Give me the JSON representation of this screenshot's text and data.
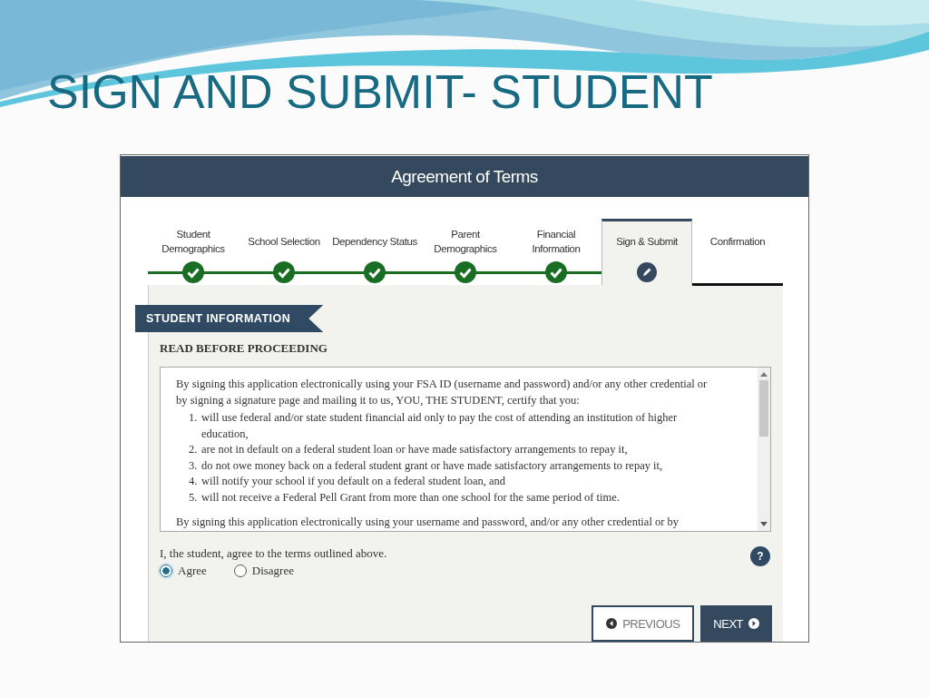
{
  "slide_title": "SIGN AND SUBMIT- STUDENT",
  "page_header": "Agreement of Terms",
  "steps": [
    {
      "label": "Student Demographics",
      "complete": true,
      "selected": false
    },
    {
      "label": "School Selection",
      "complete": true,
      "selected": false
    },
    {
      "label": "Dependency Status",
      "complete": true,
      "selected": false
    },
    {
      "label": "Parent Demographics",
      "complete": true,
      "selected": false
    },
    {
      "label": "Financial Information",
      "complete": true,
      "selected": false
    },
    {
      "label": "Sign & Submit",
      "complete": false,
      "selected": true
    },
    {
      "label": "Confirmation",
      "complete": false,
      "selected": false
    }
  ],
  "section": "STUDENT INFORMATION",
  "heading": "READ BEFORE PROCEEDING",
  "terms": {
    "intro": "By signing this application electronically using your FSA ID (username and password) and/or any other credential or by signing a signature page and mailing it to us, YOU, THE STUDENT, certify that you:",
    "items": [
      {
        "number": "1.",
        "text": "will use federal and/or state student financial aid only to pay the cost of attending an institution of higher education,"
      },
      {
        "number": "2.",
        "text": "are not in default on a federal student loan or have made satisfactory arrangements to repay it,"
      },
      {
        "number": "3.",
        "text": "do not owe money back on a federal student grant or have made satisfactory arrangements to repay it,"
      },
      {
        "number": "4.",
        "text": "will notify your school if you default on a federal student loan, and"
      },
      {
        "number": "5.",
        "text": "will not receive a Federal Pell Grant from more than one school for the same period of time."
      }
    ],
    "closing": "By signing this application electronically using your username and password, and/or any other credential or by"
  },
  "agreement": {
    "prompt": "I, the student, agree to the terms outlined above.",
    "help": "?",
    "options": [
      {
        "label": "Agree",
        "selected": true
      },
      {
        "label": "Disagree",
        "selected": false
      }
    ]
  },
  "buttons": [
    {
      "kind": "previous",
      "label": "PREVIOUS"
    },
    {
      "kind": "next",
      "label": "NEXT"
    }
  ]
}
